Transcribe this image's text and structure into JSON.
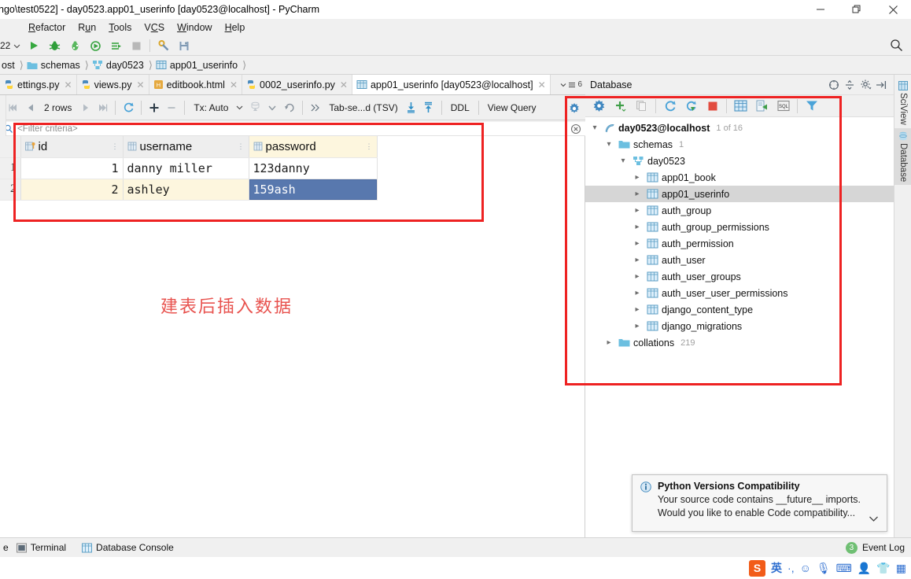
{
  "window": {
    "title": "ngo\\test0522] - day0523.app01_userinfo [day0523@localhost] - PyCharm",
    "minimize_label": "minimize-icon",
    "maximize_label": "restore-icon",
    "close_label": "close-icon"
  },
  "menubar": {
    "items": [
      {
        "label": "Refactor"
      },
      {
        "label": "Run"
      },
      {
        "label": "Tools"
      },
      {
        "label": "VCS"
      },
      {
        "label": "Window"
      },
      {
        "label": "Help"
      }
    ]
  },
  "toolbar": {
    "run_config": "22",
    "icons": [
      "run-icon",
      "debug-icon",
      "coverage-icon",
      "profile-icon",
      "run-with-console-icon",
      "stop-icon",
      "settings-wrench-icon",
      "save-all-icon"
    ],
    "search_icon": "search-icon"
  },
  "breadcrumb": {
    "items": [
      {
        "label": "ost",
        "icon": "database-icon"
      },
      {
        "label": "schemas",
        "icon": "folder-icon"
      },
      {
        "label": "day0523",
        "icon": "schema-icon"
      },
      {
        "label": "app01_userinfo",
        "icon": "table-icon"
      }
    ]
  },
  "editor_tabs": {
    "tabs": [
      {
        "label": "ettings.py",
        "icon": "python-file-icon",
        "active": false
      },
      {
        "label": "views.py",
        "icon": "python-file-icon",
        "active": false
      },
      {
        "label": "editbook.html",
        "icon": "html-file-icon",
        "active": false
      },
      {
        "label": "0002_userinfo.py",
        "icon": "python-file-icon",
        "active": false
      },
      {
        "label": "app01_userinfo [day0523@localhost]",
        "icon": "table-icon",
        "active": true
      }
    ],
    "overflow_count": "6"
  },
  "data_toolbar": {
    "first_page": "first-page-icon",
    "prev_page": "prev-page-icon",
    "rows_label": "2 rows",
    "next_page": "next-page-icon",
    "last_page": "last-page-icon",
    "reload": "reload-icon",
    "add_row": "add-row-icon",
    "delete_row": "delete-row-icon",
    "tx_label": "Tx: Auto",
    "submit": "submit-db-icon",
    "dropdown": "chevron-down-icon",
    "rollback": "rollback-icon",
    "expand": "chevron-double-right-icon",
    "format_label": "Tab-se...d (TSV)",
    "import_icon": "import-icon",
    "export_icon": "export-icon",
    "ddl_label": "DDL",
    "view_query_label": "View Query",
    "settings_icon": "grid-settings-icon"
  },
  "filter": {
    "icon": "filter-icon",
    "placeholder": "<Filter criteria>",
    "clear_icon": "clear-filter-icon"
  },
  "grid": {
    "row_header_title": "",
    "columns": [
      {
        "name": "id",
        "icon": "primary-key-column-icon",
        "selected": false
      },
      {
        "name": "username",
        "icon": "column-icon",
        "selected": false
      },
      {
        "name": "password",
        "icon": "column-icon",
        "selected": true
      }
    ],
    "rows": [
      {
        "num": "1",
        "id": "1",
        "username": "danny miller",
        "password": "123danny",
        "selected_cell": null
      },
      {
        "num": "2",
        "id": "2",
        "username": "ashley",
        "password": "159ash",
        "selected_cell": "password"
      }
    ]
  },
  "annotation": {
    "note_cn": "建表后插入数据",
    "note_color": "#e8534f",
    "box_color": "#ee2222"
  },
  "database_panel": {
    "title": "Database",
    "header_icons": [
      "collapse-all-icon",
      "expand-icon",
      "gear-icon",
      "hide-icon"
    ],
    "toolbar_icons": [
      "data-source-properties-icon",
      "add-icon",
      "copy-icon",
      "refresh-icon",
      "sync-icon",
      "stop-icon",
      "table-editor-icon",
      "jump-to-console-icon",
      "sql-console-icon",
      "filter-icon"
    ],
    "tree": [
      {
        "label": "day0523@localhost",
        "count": "1 of 16",
        "icon": "data-source-icon",
        "indent": 0,
        "expanded": true,
        "bold": true,
        "selected": false
      },
      {
        "label": "schemas",
        "count": "1",
        "icon": "folder-icon",
        "indent": 1,
        "expanded": true,
        "bold": false,
        "selected": false
      },
      {
        "label": "day0523",
        "count": "",
        "icon": "schema-icon",
        "indent": 2,
        "expanded": true,
        "bold": false,
        "selected": false
      },
      {
        "label": "app01_book",
        "count": "",
        "icon": "table-icon",
        "indent": 3,
        "expanded": false,
        "bold": false,
        "selected": false
      },
      {
        "label": "app01_userinfo",
        "count": "",
        "icon": "table-icon",
        "indent": 3,
        "expanded": false,
        "bold": false,
        "selected": true
      },
      {
        "label": "auth_group",
        "count": "",
        "icon": "table-icon",
        "indent": 3,
        "expanded": false,
        "bold": false,
        "selected": false
      },
      {
        "label": "auth_group_permissions",
        "count": "",
        "icon": "table-icon",
        "indent": 3,
        "expanded": false,
        "bold": false,
        "selected": false
      },
      {
        "label": "auth_permission",
        "count": "",
        "icon": "table-icon",
        "indent": 3,
        "expanded": false,
        "bold": false,
        "selected": false
      },
      {
        "label": "auth_user",
        "count": "",
        "icon": "table-icon",
        "indent": 3,
        "expanded": false,
        "bold": false,
        "selected": false
      },
      {
        "label": "auth_user_groups",
        "count": "",
        "icon": "table-icon",
        "indent": 3,
        "expanded": false,
        "bold": false,
        "selected": false
      },
      {
        "label": "auth_user_user_permissions",
        "count": "",
        "icon": "table-icon",
        "indent": 3,
        "expanded": false,
        "bold": false,
        "selected": false
      },
      {
        "label": "django_content_type",
        "count": "",
        "icon": "table-icon",
        "indent": 3,
        "expanded": false,
        "bold": false,
        "selected": false
      },
      {
        "label": "django_migrations",
        "count": "",
        "icon": "table-icon",
        "indent": 3,
        "expanded": false,
        "bold": false,
        "selected": false
      },
      {
        "label": "collations",
        "count": "219",
        "icon": "folder-icon",
        "indent": 1,
        "expanded": false,
        "bold": false,
        "selected": false
      }
    ]
  },
  "right_tabs": [
    {
      "label": "SciView",
      "icon": "sciview-icon",
      "active": false
    },
    {
      "label": "Database",
      "icon": "database-icon",
      "active": true
    }
  ],
  "notification": {
    "icon": "info-icon",
    "title": "Python Versions Compatibility",
    "line1": "Your source code contains __future__ imports.",
    "line2": "Would you like to enable Code compatibility...",
    "chevron": "chevron-down-icon"
  },
  "statusbar": {
    "left_truncated": "e",
    "items": [
      {
        "label": "Terminal",
        "icon": "terminal-icon"
      },
      {
        "label": "Database Console",
        "icon": "db-console-icon"
      }
    ],
    "event_log_label": "Event Log",
    "event_log_count": "3"
  },
  "taskbar": {
    "tray_items": [
      "sogou-icon",
      "chinese-input-icon",
      "punctuation-icon",
      "emoji-icon",
      "mic-icon",
      "keyboard-icon",
      "user-icon",
      "skin-icon",
      "apps-icon"
    ]
  }
}
